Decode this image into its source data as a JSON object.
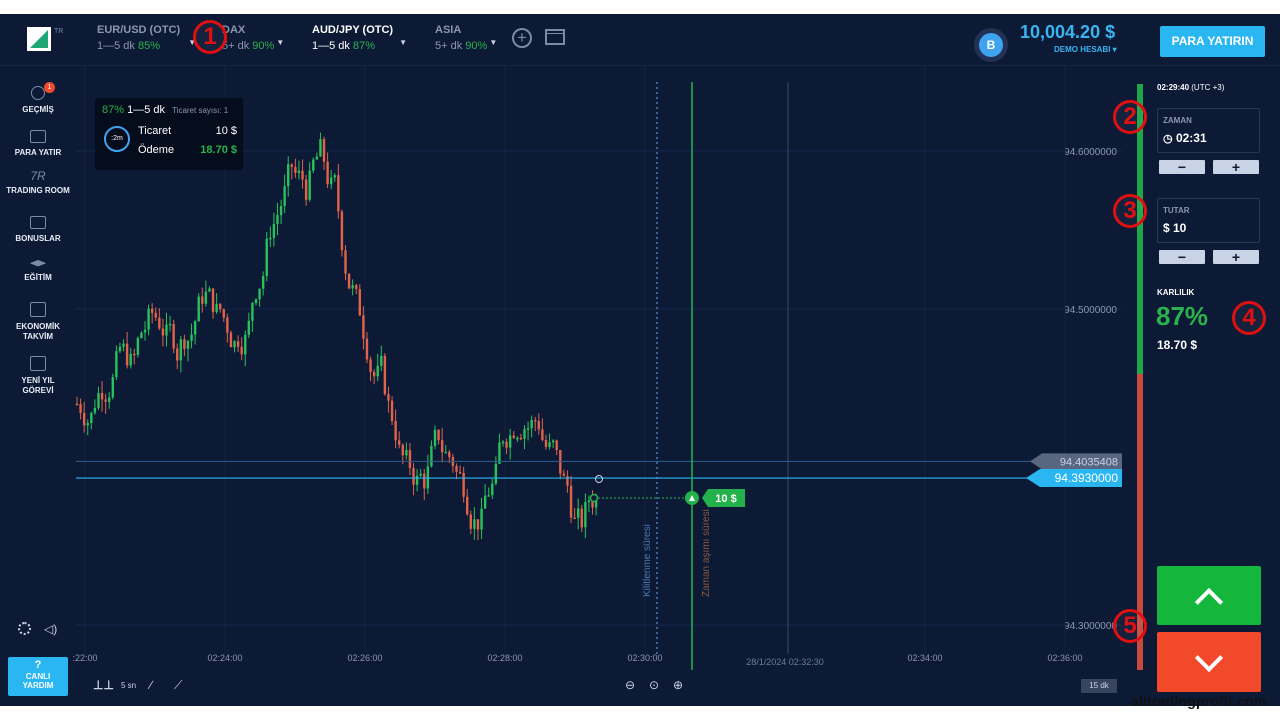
{
  "header": {
    "logo_text": "TR",
    "assets": [
      {
        "name": "EUR/USD (OTC)",
        "duration": "1—5 dk",
        "percent": "85%"
      },
      {
        "name": "DAX",
        "duration": "5+ dk",
        "percent": "90%"
      },
      {
        "name": "AUD/JPY (OTC)",
        "duration": "1—5 dk",
        "percent": "87%"
      },
      {
        "name": "ASIA",
        "duration": "5+ dk",
        "percent": "90%"
      }
    ],
    "balance_icon": "B",
    "balance": "10,004.20 $",
    "account": "DEMO HESABI",
    "deposit_label": "PARA YATIRIN"
  },
  "sidebar": {
    "items": [
      {
        "label": "GEÇMİŞ",
        "icon": "history-icon",
        "badge": "1"
      },
      {
        "label": "PARA YATIR",
        "icon": "wallet-icon"
      },
      {
        "label": "TRADING ROOM",
        "icon": "tr-icon",
        "icon_text": "7R"
      },
      {
        "label": "BONUSLAR",
        "icon": "bonus-icon"
      },
      {
        "label": "EĞİTİM",
        "icon": "graduation-icon"
      },
      {
        "label": "EKONOMİK TAKVİM",
        "icon": "calendar-icon"
      },
      {
        "label": "YENİ YIL GÖREVİ",
        "icon": "scroll-icon"
      }
    ],
    "help_mark": "?",
    "help_label": "CANLI YARDIM"
  },
  "tradebox": {
    "percent": "87%",
    "duration": "1—5 dk",
    "count_label": "Ticaret sayısı: 1",
    "timer": ":2m",
    "trade_label": "Ticaret",
    "trade_value": "10 $",
    "payout_label": "Ödeme",
    "payout_value": "18.70 $"
  },
  "right_panel": {
    "clock": "02:29:40",
    "tz": "(UTC +3)",
    "time_label": "ZAMAN",
    "time_value": "02:31",
    "amount_label": "TUTAR",
    "amount_value": "$ 10",
    "profit_label": "KARLILIK",
    "profit_percent": "87%",
    "profit_value": "18.70 $",
    "minus": "−",
    "plus": "+"
  },
  "markers": [
    "1",
    "2",
    "3",
    "4",
    "5"
  ],
  "chart_data": {
    "type": "candlestick",
    "price_ticks": [
      "94.6000000",
      "94.5000000",
      "94.3000000"
    ],
    "time_ticks": [
      ":22:00",
      "02:24:00",
      "02:26:00",
      "02:28:00",
      "02:30:00",
      "02:34:00",
      "02:36:00"
    ],
    "expiry_label": "28/1/2024 02:32:30",
    "last_price": "94.3930000",
    "prev_price": "94.4035408",
    "trade_tag": "10 $",
    "lock_label": "Kilitlenme süresi",
    "expiry_line_label": "Zaman aşımı süresi",
    "colors": {
      "up": "#29c15a",
      "down": "#e2624a",
      "line": "#27b14a"
    }
  },
  "bottom": {
    "interval": "5 sn",
    "period": "15 dk"
  },
  "watermark": "alltradingprofit.com"
}
